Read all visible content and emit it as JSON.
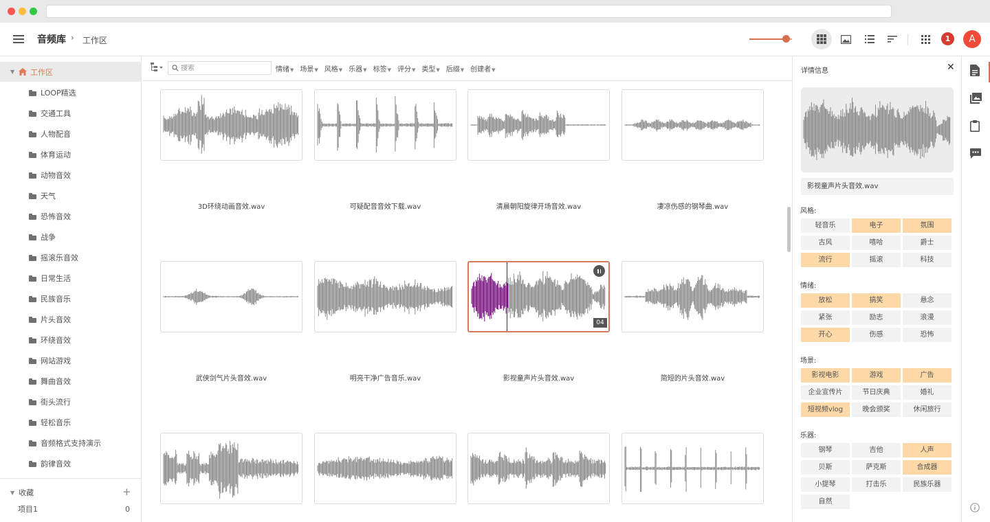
{
  "app": {
    "title": "音频库",
    "breadcrumb": "工作区",
    "breadcrumb_sep": "›"
  },
  "header": {
    "zoom_value": 0.87,
    "notification_count": "1",
    "avatar_letter": "A"
  },
  "sidebar": {
    "root_label": "工作区",
    "folders": [
      "LOOP精选",
      "交通工具",
      "人物配音",
      "体育运动",
      "动物音效",
      "天气",
      "恐怖音效",
      "战争",
      "摇滚乐音效",
      "日常生活",
      "民族音乐",
      "片头音效",
      "环绕音效",
      "网站游戏",
      "舞曲音效",
      "街头流行",
      "轻松音乐",
      "音频格式支持演示",
      "韵律音效"
    ],
    "favorites_label": "收藏",
    "favorite_item": {
      "label": "项目1",
      "count": "0"
    }
  },
  "filterbar": {
    "search_placeholder": "搜索",
    "filters": [
      "情绪",
      "场景",
      "风格",
      "乐器",
      "标签",
      "评分",
      "类型",
      "后缀",
      "创建者"
    ]
  },
  "grid": {
    "items": [
      {
        "name": "3D环绕动画音效.wav"
      },
      {
        "name": "可疑配音音效下载.wav"
      },
      {
        "name": "清晨朝阳旋律开场音效.wav"
      },
      {
        "name": "凄凉伤感的钢琴曲.wav"
      },
      {
        "name": "武侠剑气片头音效.wav"
      },
      {
        "name": "明亮干净广告音乐.wav"
      },
      {
        "name": "影视童声片头音效.wav",
        "selected": true,
        "track_number": "04",
        "progress": 0.27
      },
      {
        "name": "简短的片头音效.wav"
      },
      {
        "name": ""
      },
      {
        "name": ""
      },
      {
        "name": ""
      },
      {
        "name": ""
      }
    ]
  },
  "details": {
    "title": "详情信息",
    "filename": "影视童声片头音效.wav",
    "sections": [
      {
        "label": "风格:",
        "tags": [
          {
            "t": "轻音乐",
            "on": false
          },
          {
            "t": "电子",
            "on": true
          },
          {
            "t": "氛围",
            "on": true
          },
          {
            "t": "古风",
            "on": false
          },
          {
            "t": "嘻哈",
            "on": false
          },
          {
            "t": "爵士",
            "on": false
          },
          {
            "t": "流行",
            "on": true
          },
          {
            "t": "摇滚",
            "on": false
          },
          {
            "t": "科技",
            "on": false
          }
        ]
      },
      {
        "label": "情绪:",
        "tags": [
          {
            "t": "放松",
            "on": true
          },
          {
            "t": "搞笑",
            "on": true
          },
          {
            "t": "悬念",
            "on": false
          },
          {
            "t": "紧张",
            "on": false
          },
          {
            "t": "励志",
            "on": false
          },
          {
            "t": "浪漫",
            "on": false
          },
          {
            "t": "开心",
            "on": true
          },
          {
            "t": "伤感",
            "on": false
          },
          {
            "t": "恐怖",
            "on": false
          }
        ]
      },
      {
        "label": "场景:",
        "tags": [
          {
            "t": "影视电影",
            "on": true
          },
          {
            "t": "游戏",
            "on": true
          },
          {
            "t": "广告",
            "on": true
          },
          {
            "t": "企业宣传片",
            "on": false
          },
          {
            "t": "节日庆典",
            "on": false
          },
          {
            "t": "婚礼",
            "on": false
          },
          {
            "t": "短视频vlog",
            "on": true
          },
          {
            "t": "晚会颁奖",
            "on": false
          },
          {
            "t": "休闲旅行",
            "on": false
          }
        ]
      },
      {
        "label": "乐器:",
        "tags": [
          {
            "t": "钢琴",
            "on": false
          },
          {
            "t": "吉他",
            "on": false
          },
          {
            "t": "人声",
            "on": true
          },
          {
            "t": "贝斯",
            "on": false
          },
          {
            "t": "萨克斯",
            "on": false
          },
          {
            "t": "合成器",
            "on": true
          },
          {
            "t": "小提琴",
            "on": false
          },
          {
            "t": "打击乐",
            "on": false
          },
          {
            "t": "民族乐器",
            "on": false
          },
          {
            "t": "自然",
            "on": false
          }
        ]
      }
    ]
  },
  "colors": {
    "accent": "#d7704f",
    "tag_on": "#fcd9a6",
    "waveform": "#8a8a8a",
    "played": "#7a1380"
  }
}
